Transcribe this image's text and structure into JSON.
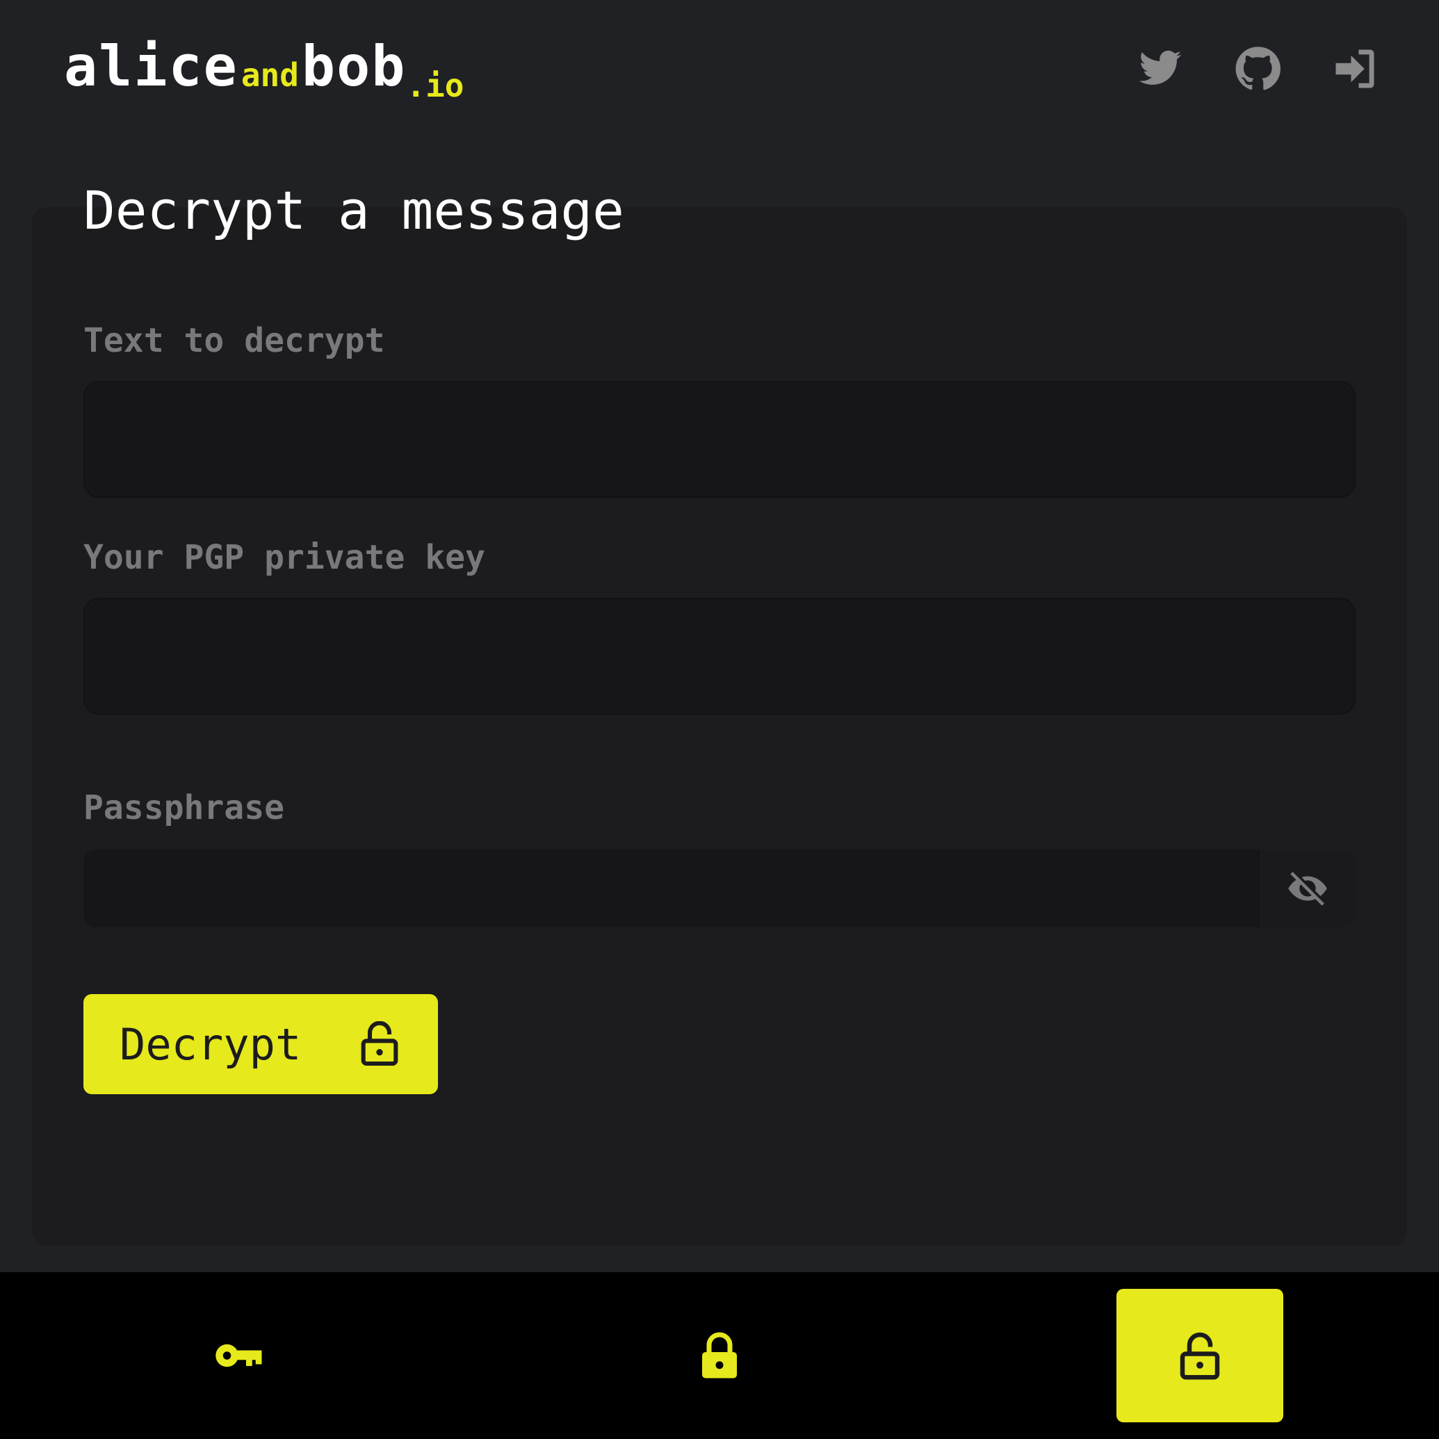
{
  "header": {
    "logo": {
      "part1": "alice",
      "part2": "and",
      "part3": "bob",
      "part4": ".io"
    },
    "icons": [
      "twitter-icon",
      "github-icon",
      "sign-in-icon"
    ]
  },
  "page": {
    "title": "Decrypt a message"
  },
  "form": {
    "text_label": "Text to decrypt",
    "text_value": "",
    "key_label": "Your PGP private key",
    "key_value": "",
    "passphrase_label": "Passphrase",
    "passphrase_value": "",
    "decrypt_label": "Decrypt"
  },
  "bottom_nav": {
    "items": [
      {
        "icon": "key-icon",
        "active": false
      },
      {
        "icon": "lock-icon",
        "active": false
      },
      {
        "icon": "unlock-icon",
        "active": true
      }
    ]
  },
  "colors": {
    "accent": "#e6e91b",
    "background": "#202125",
    "card": "#1c1c1e",
    "muted": "#79797b"
  }
}
